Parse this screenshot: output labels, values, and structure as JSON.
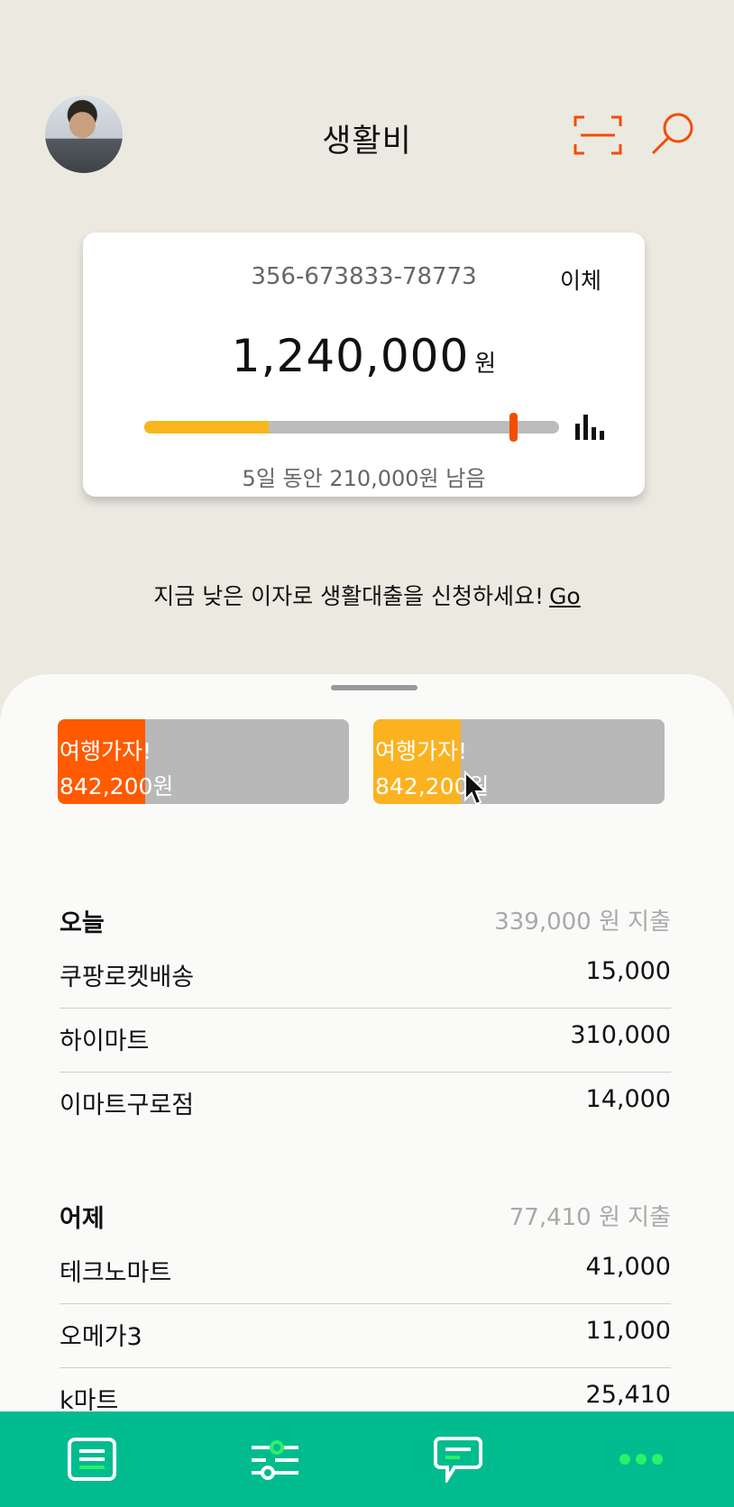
{
  "header": {
    "title": "생활비"
  },
  "account": {
    "number": "356-673833-78773",
    "transfer_label": "이체",
    "balance": "1,240,000",
    "balance_unit": "원",
    "budget_used_fraction": 0.3,
    "marker_fraction": 0.89,
    "remaining_text": "5일 동안 210,000원 남음"
  },
  "promo": {
    "text": "지금 낮은 이자로 생활대출을 신청하세요!",
    "link": "Go"
  },
  "goals": [
    {
      "name": "여행가자!",
      "amount": "842,200원",
      "progress": 0.3,
      "color": "#ff5a00"
    },
    {
      "name": "여행가자!",
      "amount": "842,200원",
      "progress": 0.3,
      "color": "#fbb21e"
    }
  ],
  "sections": [
    {
      "title": "오늘",
      "spend": "339,000 원 지출",
      "items": [
        {
          "name": "쿠팡로켓배송",
          "amount": "15,000"
        },
        {
          "name": "하이마트",
          "amount": "310,000"
        },
        {
          "name": "이마트구로점",
          "amount": "14,000"
        }
      ]
    },
    {
      "title": "어제",
      "spend": "77,410 원 지출",
      "items": [
        {
          "name": "테크노마트",
          "amount": "41,000"
        },
        {
          "name": "오메가3",
          "amount": "11,000"
        },
        {
          "name": "k마트",
          "amount": "25,410"
        }
      ]
    }
  ],
  "colors": {
    "accent": "#f04e00",
    "budget_fill": "#f9b61c",
    "tabbar": "#00bc8e",
    "tab_highlight": "#2cf06a"
  },
  "tabs": [
    {
      "icon": "list-icon"
    },
    {
      "icon": "sliders-icon"
    },
    {
      "icon": "chat-icon"
    },
    {
      "icon": "more-icon"
    }
  ]
}
